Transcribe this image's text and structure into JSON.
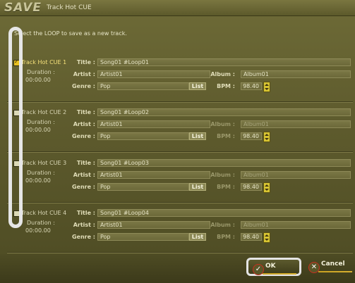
{
  "window": {
    "title_prefix": "SAVE",
    "title": "Track Hot CUE"
  },
  "instruction": "Select the LOOP to save as a new track.",
  "labels": {
    "title": "Title :",
    "artist": "Artist :",
    "album": "Album :",
    "genre": "Genre :",
    "bpm": "BPM :",
    "duration": "Duration :",
    "list": "List"
  },
  "tracks": [
    {
      "name": "Track Hot CUE 1",
      "checked": true,
      "duration": "00:00.00",
      "title": "Song01 #Loop01",
      "artist": "Artist01",
      "album": "Album01",
      "genre": "Pop",
      "bpm": "98.40"
    },
    {
      "name": "Track Hot CUE 2",
      "checked": false,
      "duration": "00:00.00",
      "title": "Song01 #Loop02",
      "artist": "Artist01",
      "album": "Album01",
      "genre": "Pop",
      "bpm": "98.40"
    },
    {
      "name": "Track Hot CUE 3",
      "checked": false,
      "duration": "00:00.00",
      "title": "Song01 #Loop03",
      "artist": "Artist01",
      "album": "Album01",
      "genre": "Pop",
      "bpm": "98.40"
    },
    {
      "name": "Track Hot CUE 4",
      "checked": false,
      "duration": "00:00.00",
      "title": "Song01 #Loop04",
      "artist": "Artist01",
      "album": "Album01",
      "genre": "Pop",
      "bpm": "98.40"
    }
  ],
  "buttons": {
    "ok": "OK",
    "cancel": "Cancel"
  },
  "icons": {
    "ok": "check-icon",
    "cancel": "close-icon"
  },
  "colors": {
    "accent_yellow": "#e8c020",
    "ok_highlight_ring": "#c83020",
    "selection_outline": "#e6e6e6"
  }
}
